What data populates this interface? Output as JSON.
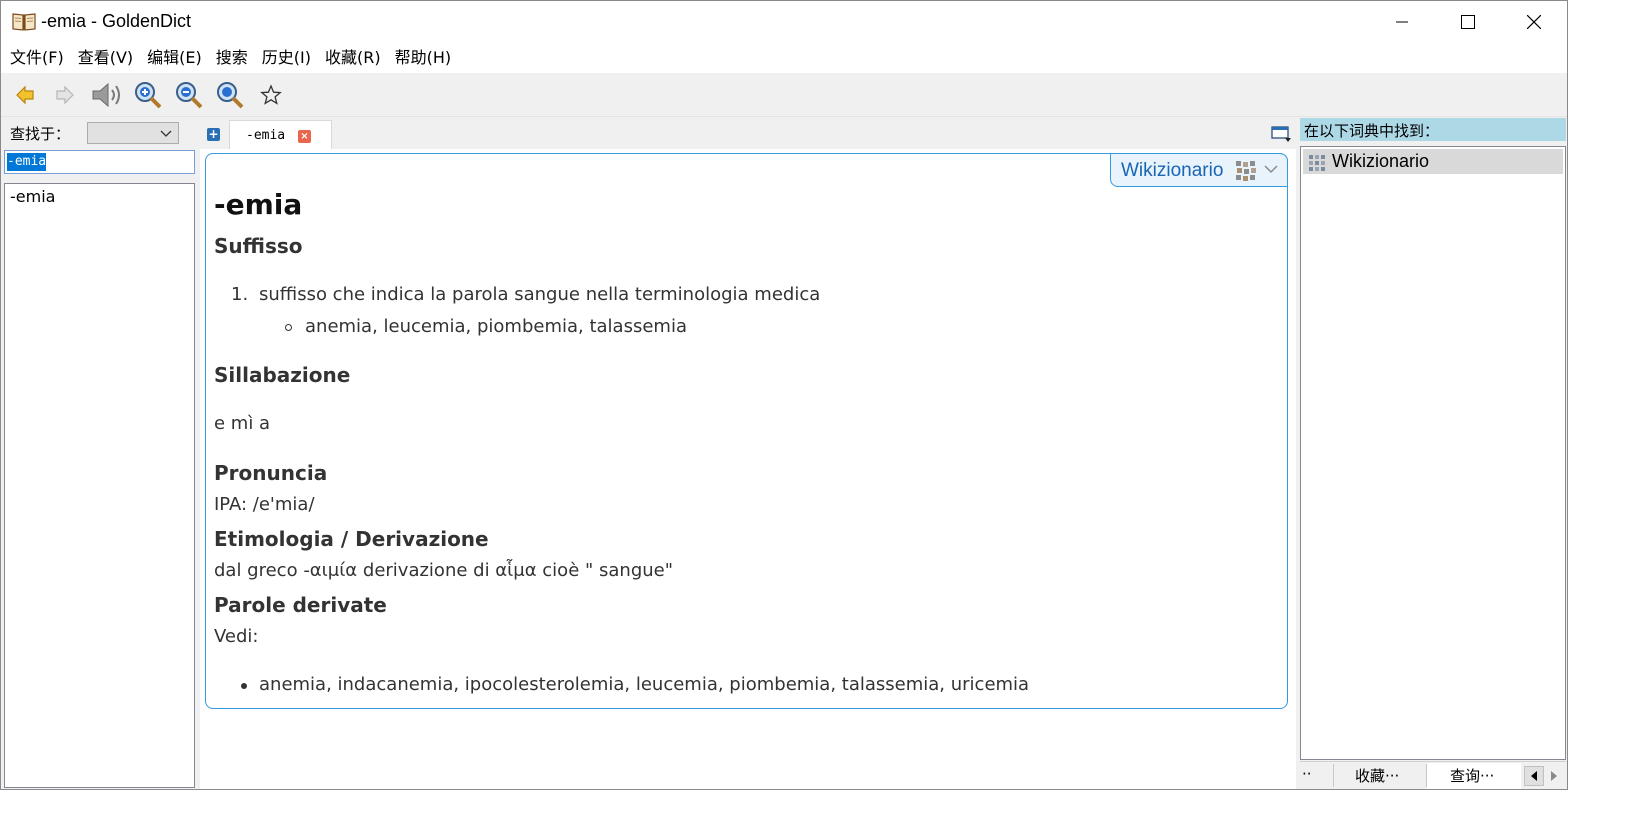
{
  "window": {
    "title": "-emia - GoldenDict"
  },
  "menu": {
    "items": [
      "文件(F)",
      "查看(V)",
      "编辑(E)",
      "搜索",
      "历史(I)",
      "收藏(R)",
      "帮助(H)"
    ]
  },
  "toolbar": {
    "buttons": [
      "back-icon",
      "forward-icon",
      "speaker-icon",
      "zoom-in-icon",
      "zoom-out-icon",
      "zoom-reset-icon",
      "star-icon"
    ]
  },
  "left": {
    "search_in_label": "查找于：",
    "group_value": "",
    "search_value": "-emia",
    "word_list": [
      "-emia"
    ]
  },
  "tabs": {
    "active_label": "-emia"
  },
  "article": {
    "dictionary_name": "Wikizionario",
    "headword": "-emia",
    "sections": {
      "suffisso_title": "Suffisso",
      "def_number": "1.",
      "def_text": "suffisso che indica la parola sangue nella terminologia medica",
      "def_examples": "anemia, leucemia, piombemia, talassemia",
      "sillabazione_title": "Sillabazione",
      "sillabazione_text": "e mì a",
      "pronuncia_title": "Pronuncia",
      "pronuncia_text": "IPA: /e'mia/",
      "etimologia_title": "Etimologia / Derivazione",
      "etimologia_text": "dal greco -αιμία derivazione di αἷμα cioè \" sangue\"",
      "derivate_title": "Parole derivate",
      "derivate_text": "Vedi:",
      "derivate_list": "anemia, indacanemia, ipocolesterolemia, leucemia, piombemia, talassemia, uricemia"
    }
  },
  "right": {
    "found_header": "在以下词典中找到：",
    "found_dicts": [
      "Wikizionario"
    ],
    "bottom_tabs": {
      "left_stub": "··",
      "favorites": "收藏···",
      "search": "查询···"
    }
  },
  "colors": {
    "accent": "#3399e0",
    "found_header_bg": "#add8e6",
    "selection": "#0078d7"
  }
}
